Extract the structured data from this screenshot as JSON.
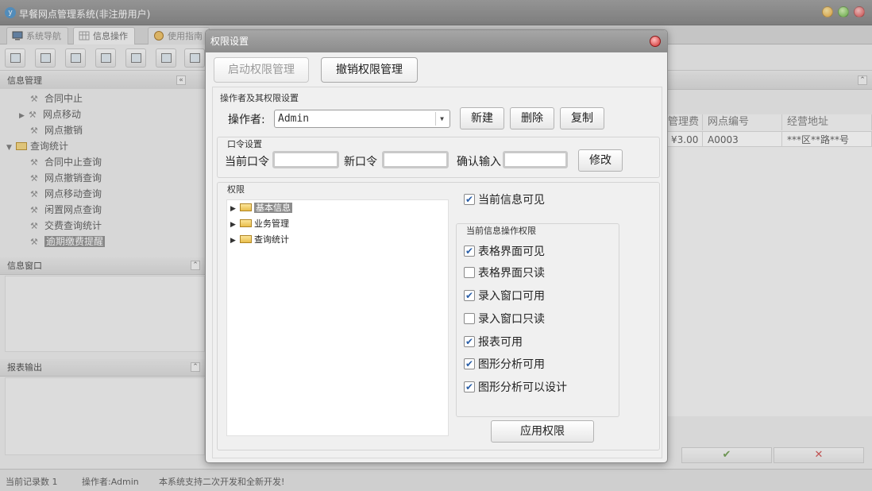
{
  "app": {
    "title": "早餐网点管理系统(非注册用户)",
    "logo_glyph": "y"
  },
  "tabs": [
    {
      "label": "系统导航"
    },
    {
      "label": "信息操作"
    },
    {
      "label": "使用指南"
    }
  ],
  "left_panel": {
    "info_manage_title": "信息管理",
    "tree": [
      {
        "label": "合同中止",
        "type": "leaf"
      },
      {
        "label": "网点移动",
        "type": "collapsed"
      },
      {
        "label": "网点撤销",
        "type": "leaf"
      },
      {
        "label": "查询统计",
        "type": "folder-open"
      },
      {
        "label": "合同中止查询",
        "type": "leaf"
      },
      {
        "label": "网点撤销查询",
        "type": "leaf"
      },
      {
        "label": "网点移动查询",
        "type": "leaf"
      },
      {
        "label": "闲置网点查询",
        "type": "leaf"
      },
      {
        "label": "交费查询统计",
        "type": "leaf"
      },
      {
        "label": "逾期缴费提醒",
        "type": "leaf",
        "selected": true
      }
    ],
    "info_window_title": "信息窗口",
    "report_output_title": "报表输出"
  },
  "grid": {
    "headers": [
      "管理费",
      "网点编号",
      "经营地址"
    ],
    "rows": [
      [
        "¥3.00",
        "A0003",
        "***区**路**号"
      ]
    ],
    "confirm_glyph": "✔",
    "cancel_glyph": "✕"
  },
  "statusbar": {
    "record_count": "当前记录数 1",
    "operator": "操作者:Admin",
    "notice": "本系统支持二次开发和全新开发!"
  },
  "dialog": {
    "title": "权限设置",
    "tab_enable": "启动权限管理",
    "tab_revoke": "撤销权限管理",
    "operator_section": "操作者及其权限设置",
    "operator_label": "操作者:",
    "operator_value": "Admin",
    "btn_new": "新建",
    "btn_delete": "删除",
    "btn_copy": "复制",
    "password_section": "口令设置",
    "current_password_label": "当前口令",
    "new_password_label": "新口令",
    "confirm_password_label": "确认输入",
    "btn_modify": "修改",
    "permission_section": "权限",
    "permission_tree": [
      {
        "label": "基本信息",
        "selected": true
      },
      {
        "label": "业务管理",
        "selected": false
      },
      {
        "label": "查询统计",
        "selected": false
      }
    ],
    "current_visible_label": "当前信息可见",
    "current_visible_checked": true,
    "ops_section": "当前信息操作权限",
    "ops": [
      {
        "label": "表格界面可见",
        "checked": true
      },
      {
        "label": "表格界面只读",
        "checked": false
      },
      {
        "label": "录入窗口可用",
        "checked": true
      },
      {
        "label": "录入窗口只读",
        "checked": false
      },
      {
        "label": "报表可用",
        "checked": true
      },
      {
        "label": "图形分析可用",
        "checked": true
      },
      {
        "label": "图形分析可以设计",
        "checked": true
      }
    ],
    "btn_apply": "应用权限"
  }
}
